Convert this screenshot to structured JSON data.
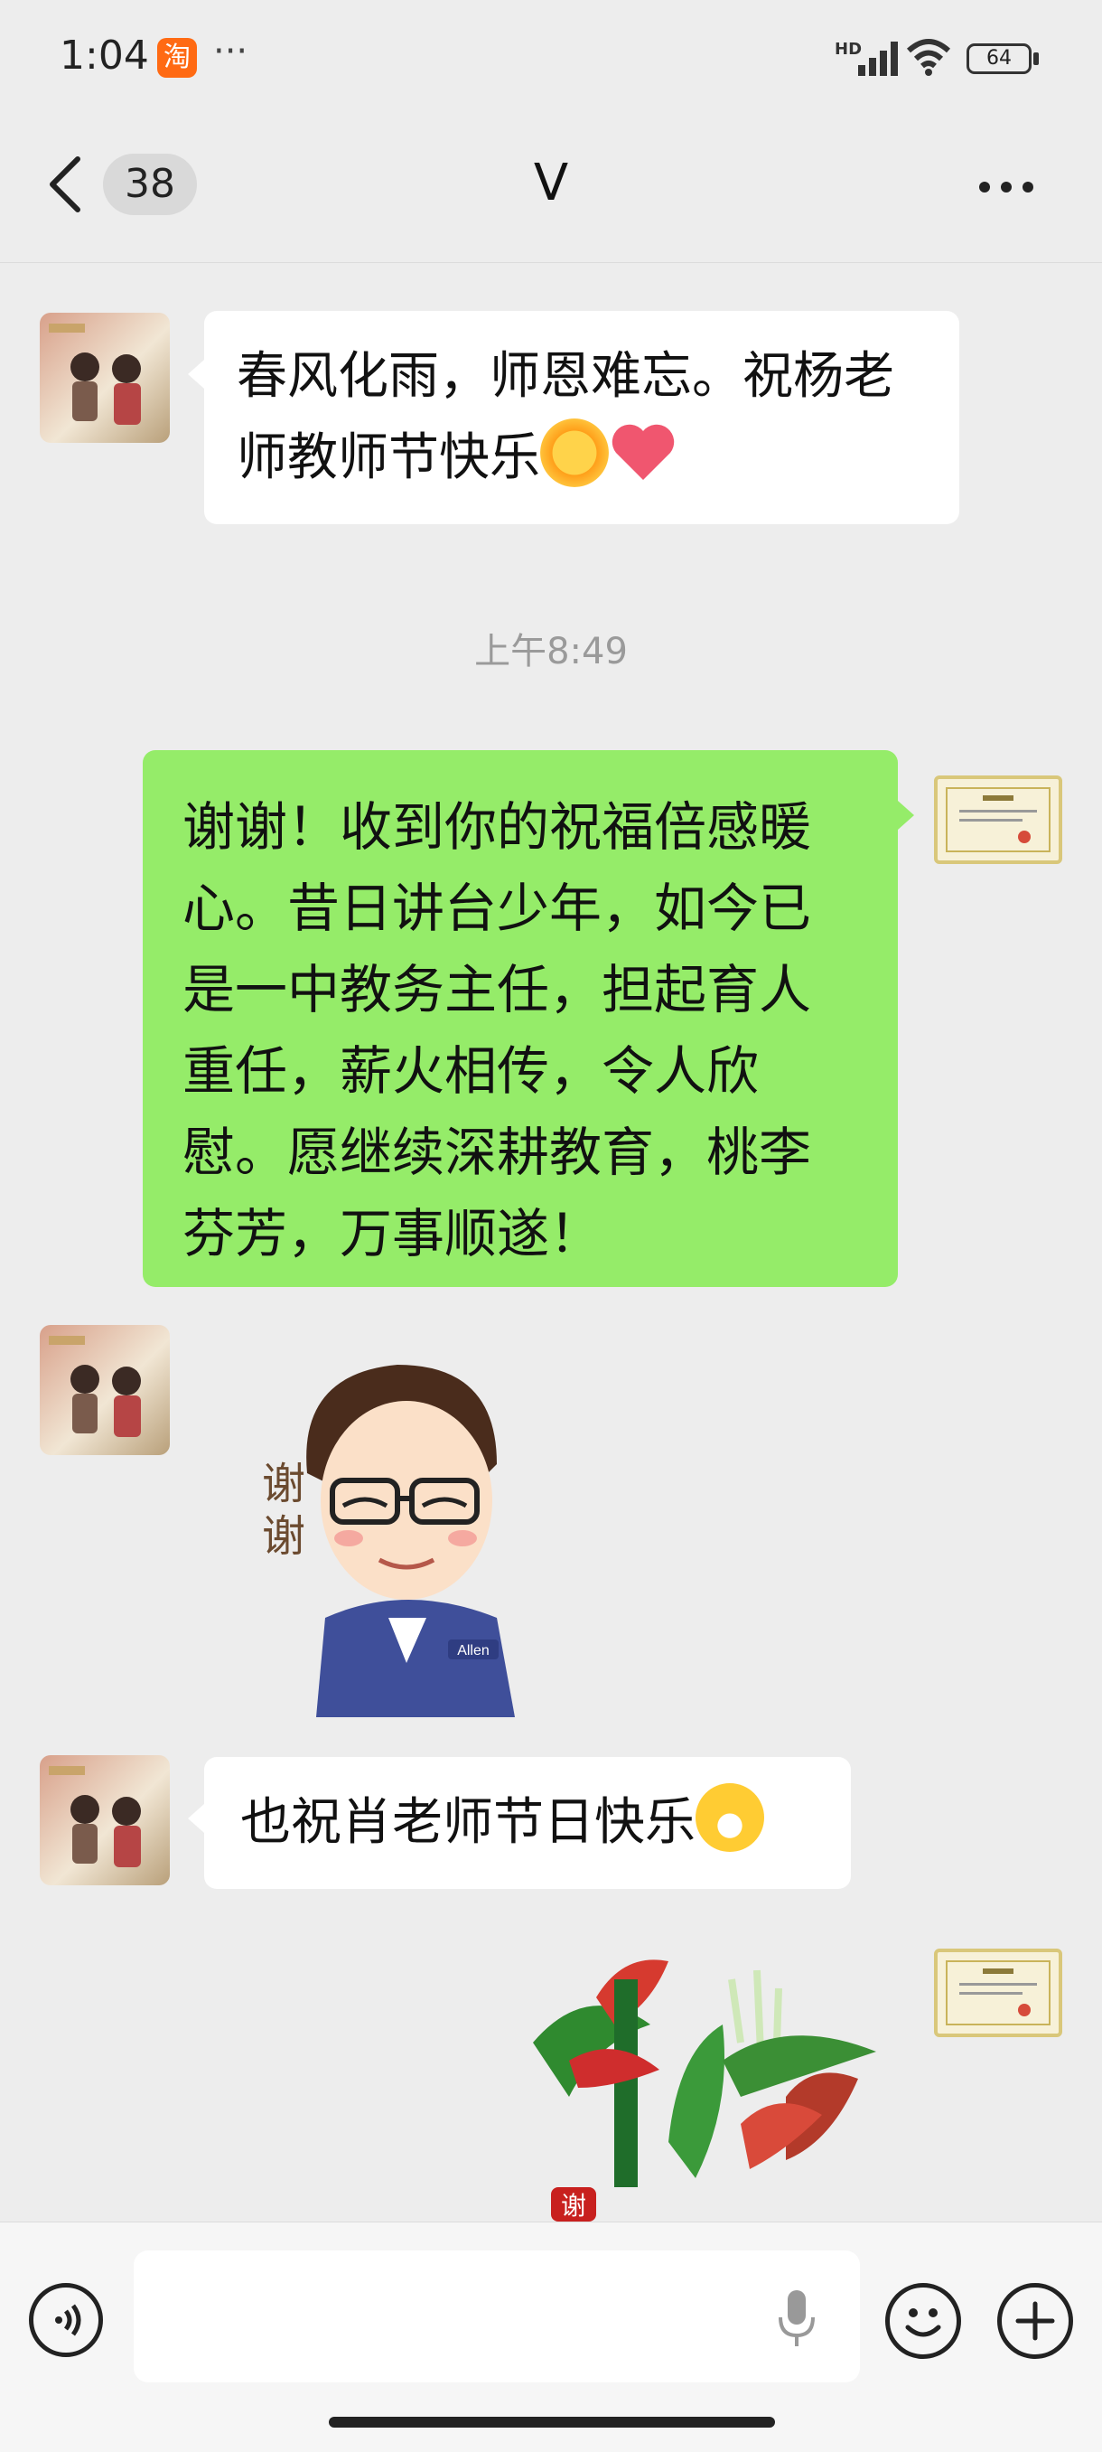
{
  "status_bar": {
    "time": "1:04",
    "app_badge": "淘",
    "more": "···",
    "network_label": "HD",
    "battery_level": "64"
  },
  "header": {
    "unread_count": "38",
    "chat_title": "V"
  },
  "messages": [
    {
      "sender": "other",
      "type": "text",
      "text": "春风化雨，师恩难忘。祝杨老师教师节快乐"
    },
    {
      "type": "timestamp",
      "text": "上午8:49"
    },
    {
      "sender": "me",
      "type": "text",
      "text": "谢谢！收到你的祝福倍感暖心。昔日讲台少年，如今已是一中教务主任，担起育人重任，薪火相传，令人欣慰。愿继续深耕教育，桃李芬芳，万事顺遂！"
    },
    {
      "sender": "other",
      "type": "sticker",
      "sticker_text": "谢谢",
      "badge_text": "Allen"
    },
    {
      "sender": "other",
      "type": "text",
      "text": "也祝肖老师节日快乐"
    },
    {
      "sender": "me",
      "type": "sticker",
      "sticker_text": "谢谢"
    }
  ],
  "colors": {
    "background": "#ededed",
    "my_bubble": "#95ec69",
    "other_bubble": "#ffffff"
  },
  "icons": [
    "back-icon",
    "more-icon",
    "voice-icon",
    "microphone-icon",
    "emoji-icon",
    "plus-icon",
    "sun-emoji",
    "heart-emoji",
    "grin-emoji"
  ]
}
